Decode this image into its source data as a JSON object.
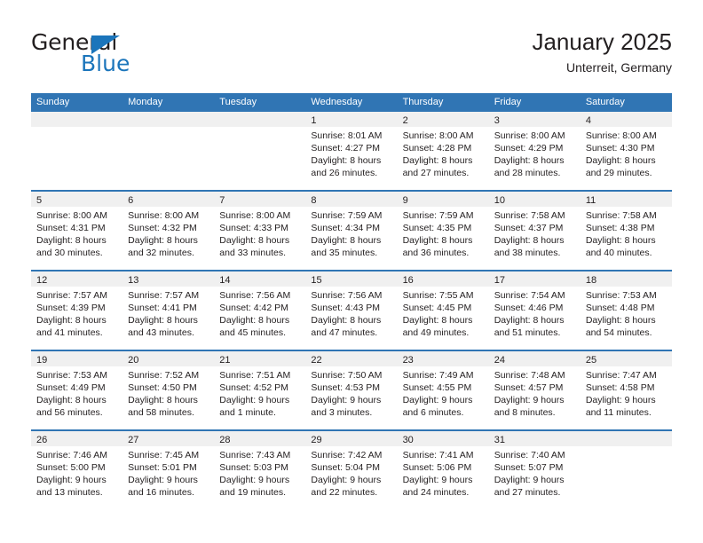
{
  "logo": {
    "word_one": "General",
    "word_two": "Blue",
    "triangle_color": "#1b75bb"
  },
  "header": {
    "title": "January 2025",
    "subtitle": "Unterreit, Germany"
  },
  "theme": {
    "header_blue": "#3075b4",
    "day_band_gray": "#f0f0f0",
    "text": "#231f20"
  },
  "weekdays": [
    "Sunday",
    "Monday",
    "Tuesday",
    "Wednesday",
    "Thursday",
    "Friday",
    "Saturday"
  ],
  "weeks": [
    [
      {
        "day": "",
        "lines": []
      },
      {
        "day": "",
        "lines": []
      },
      {
        "day": "",
        "lines": []
      },
      {
        "day": "1",
        "lines": [
          "Sunrise: 8:01 AM",
          "Sunset: 4:27 PM",
          "Daylight: 8 hours",
          "and 26 minutes."
        ]
      },
      {
        "day": "2",
        "lines": [
          "Sunrise: 8:00 AM",
          "Sunset: 4:28 PM",
          "Daylight: 8 hours",
          "and 27 minutes."
        ]
      },
      {
        "day": "3",
        "lines": [
          "Sunrise: 8:00 AM",
          "Sunset: 4:29 PM",
          "Daylight: 8 hours",
          "and 28 minutes."
        ]
      },
      {
        "day": "4",
        "lines": [
          "Sunrise: 8:00 AM",
          "Sunset: 4:30 PM",
          "Daylight: 8 hours",
          "and 29 minutes."
        ]
      }
    ],
    [
      {
        "day": "5",
        "lines": [
          "Sunrise: 8:00 AM",
          "Sunset: 4:31 PM",
          "Daylight: 8 hours",
          "and 30 minutes."
        ]
      },
      {
        "day": "6",
        "lines": [
          "Sunrise: 8:00 AM",
          "Sunset: 4:32 PM",
          "Daylight: 8 hours",
          "and 32 minutes."
        ]
      },
      {
        "day": "7",
        "lines": [
          "Sunrise: 8:00 AM",
          "Sunset: 4:33 PM",
          "Daylight: 8 hours",
          "and 33 minutes."
        ]
      },
      {
        "day": "8",
        "lines": [
          "Sunrise: 7:59 AM",
          "Sunset: 4:34 PM",
          "Daylight: 8 hours",
          "and 35 minutes."
        ]
      },
      {
        "day": "9",
        "lines": [
          "Sunrise: 7:59 AM",
          "Sunset: 4:35 PM",
          "Daylight: 8 hours",
          "and 36 minutes."
        ]
      },
      {
        "day": "10",
        "lines": [
          "Sunrise: 7:58 AM",
          "Sunset: 4:37 PM",
          "Daylight: 8 hours",
          "and 38 minutes."
        ]
      },
      {
        "day": "11",
        "lines": [
          "Sunrise: 7:58 AM",
          "Sunset: 4:38 PM",
          "Daylight: 8 hours",
          "and 40 minutes."
        ]
      }
    ],
    [
      {
        "day": "12",
        "lines": [
          "Sunrise: 7:57 AM",
          "Sunset: 4:39 PM",
          "Daylight: 8 hours",
          "and 41 minutes."
        ]
      },
      {
        "day": "13",
        "lines": [
          "Sunrise: 7:57 AM",
          "Sunset: 4:41 PM",
          "Daylight: 8 hours",
          "and 43 minutes."
        ]
      },
      {
        "day": "14",
        "lines": [
          "Sunrise: 7:56 AM",
          "Sunset: 4:42 PM",
          "Daylight: 8 hours",
          "and 45 minutes."
        ]
      },
      {
        "day": "15",
        "lines": [
          "Sunrise: 7:56 AM",
          "Sunset: 4:43 PM",
          "Daylight: 8 hours",
          "and 47 minutes."
        ]
      },
      {
        "day": "16",
        "lines": [
          "Sunrise: 7:55 AM",
          "Sunset: 4:45 PM",
          "Daylight: 8 hours",
          "and 49 minutes."
        ]
      },
      {
        "day": "17",
        "lines": [
          "Sunrise: 7:54 AM",
          "Sunset: 4:46 PM",
          "Daylight: 8 hours",
          "and 51 minutes."
        ]
      },
      {
        "day": "18",
        "lines": [
          "Sunrise: 7:53 AM",
          "Sunset: 4:48 PM",
          "Daylight: 8 hours",
          "and 54 minutes."
        ]
      }
    ],
    [
      {
        "day": "19",
        "lines": [
          "Sunrise: 7:53 AM",
          "Sunset: 4:49 PM",
          "Daylight: 8 hours",
          "and 56 minutes."
        ]
      },
      {
        "day": "20",
        "lines": [
          "Sunrise: 7:52 AM",
          "Sunset: 4:50 PM",
          "Daylight: 8 hours",
          "and 58 minutes."
        ]
      },
      {
        "day": "21",
        "lines": [
          "Sunrise: 7:51 AM",
          "Sunset: 4:52 PM",
          "Daylight: 9 hours",
          "and 1 minute."
        ]
      },
      {
        "day": "22",
        "lines": [
          "Sunrise: 7:50 AM",
          "Sunset: 4:53 PM",
          "Daylight: 9 hours",
          "and 3 minutes."
        ]
      },
      {
        "day": "23",
        "lines": [
          "Sunrise: 7:49 AM",
          "Sunset: 4:55 PM",
          "Daylight: 9 hours",
          "and 6 minutes."
        ]
      },
      {
        "day": "24",
        "lines": [
          "Sunrise: 7:48 AM",
          "Sunset: 4:57 PM",
          "Daylight: 9 hours",
          "and 8 minutes."
        ]
      },
      {
        "day": "25",
        "lines": [
          "Sunrise: 7:47 AM",
          "Sunset: 4:58 PM",
          "Daylight: 9 hours",
          "and 11 minutes."
        ]
      }
    ],
    [
      {
        "day": "26",
        "lines": [
          "Sunrise: 7:46 AM",
          "Sunset: 5:00 PM",
          "Daylight: 9 hours",
          "and 13 minutes."
        ]
      },
      {
        "day": "27",
        "lines": [
          "Sunrise: 7:45 AM",
          "Sunset: 5:01 PM",
          "Daylight: 9 hours",
          "and 16 minutes."
        ]
      },
      {
        "day": "28",
        "lines": [
          "Sunrise: 7:43 AM",
          "Sunset: 5:03 PM",
          "Daylight: 9 hours",
          "and 19 minutes."
        ]
      },
      {
        "day": "29",
        "lines": [
          "Sunrise: 7:42 AM",
          "Sunset: 5:04 PM",
          "Daylight: 9 hours",
          "and 22 minutes."
        ]
      },
      {
        "day": "30",
        "lines": [
          "Sunrise: 7:41 AM",
          "Sunset: 5:06 PM",
          "Daylight: 9 hours",
          "and 24 minutes."
        ]
      },
      {
        "day": "31",
        "lines": [
          "Sunrise: 7:40 AM",
          "Sunset: 5:07 PM",
          "Daylight: 9 hours",
          "and 27 minutes."
        ]
      },
      {
        "day": "",
        "lines": []
      }
    ]
  ]
}
